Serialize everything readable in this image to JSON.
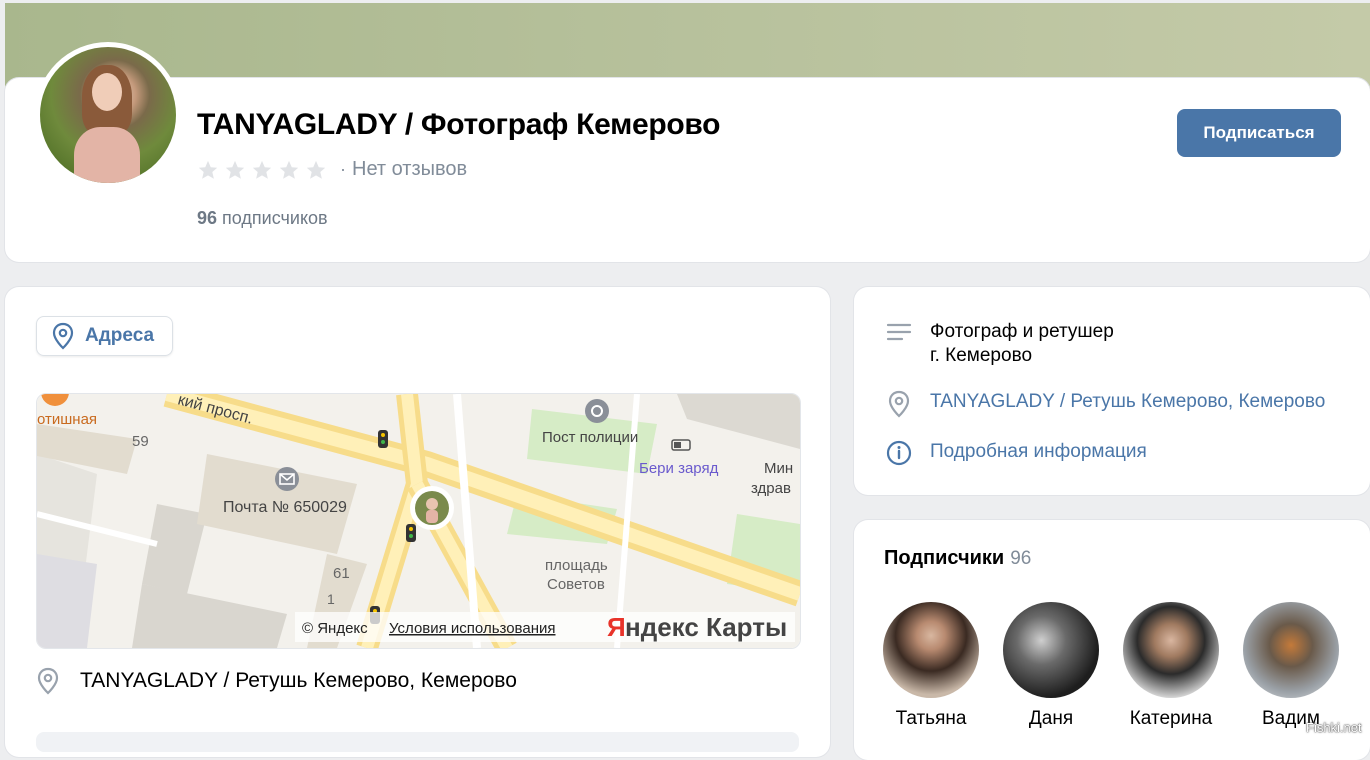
{
  "profile": {
    "title": "TANYAGLADY / Фотограф Кемерово",
    "reviews_text": "Нет отзывов",
    "rating_separator": "·",
    "subscribers_count": "96",
    "subscribers_label": "подписчиков",
    "subscribe_label": "Подписаться"
  },
  "addresses": {
    "chip_label": "Адреса",
    "address_text": "TANYAGLADY / Ретушь Кемерово, Кемерово",
    "map": {
      "street": "кий просп.",
      "place_orange": "отишная",
      "num_59": "59",
      "num_61": "61",
      "num_1": "1",
      "post_office": "Почта № 650029",
      "police": "Пост полиции",
      "charge": "Бери заряд",
      "right_edge_1": "Мин",
      "right_edge_2": "здрав",
      "square_1": "площадь",
      "square_2": "Советов",
      "copyright": "© Яндекс",
      "terms": "Условия использования",
      "brand_y": "Я",
      "brand_rest": "ндекс Карты"
    }
  },
  "info": {
    "description_line1": "Фотограф и ретушер",
    "description_line2": "г. Кемерово",
    "address_link": "TANYAGLADY / Ретушь Кемерово, Кемерово",
    "details_link": "Подробная информация"
  },
  "followers": {
    "title": "Подписчики",
    "count": "96",
    "items": [
      {
        "name": "Татьяна"
      },
      {
        "name": "Даня"
      },
      {
        "name": "Катерина"
      },
      {
        "name": "Вадим"
      }
    ]
  },
  "watermark": "Fishki.net",
  "colors": {
    "accent": "#4a76a8",
    "muted": "#818c99"
  },
  "icons": [
    "star-icon",
    "location-pin-icon",
    "menu-lines-icon",
    "info-icon",
    "mail-icon",
    "traffic-light-icon",
    "battery-icon"
  ]
}
